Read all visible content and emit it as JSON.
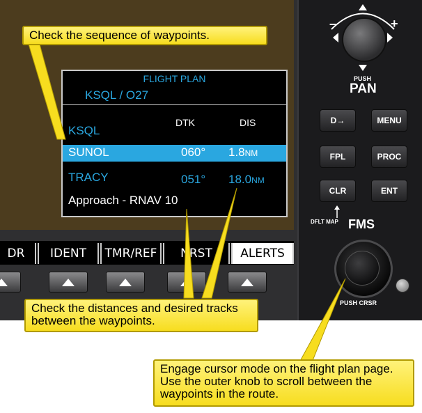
{
  "fpl": {
    "title": "FLIGHT PLAN",
    "route": "KSQL / O27",
    "col_dtk": "DTK",
    "col_dis": "DIS",
    "rows": [
      {
        "name": "KSQL",
        "dtk": "",
        "dis": "",
        "unit": ""
      },
      {
        "name": "SUNOL",
        "dtk": "060°",
        "dis": "1.8",
        "unit": "NM"
      },
      {
        "name": "TRACY",
        "dtk": "051°",
        "dis": "18.0",
        "unit": "NM"
      },
      {
        "name": "Approach - RNAV 10",
        "dtk": "",
        "dis": "",
        "unit": ""
      }
    ]
  },
  "softkeys": [
    "DR",
    "IDENT",
    "TMR/REF",
    "NRST",
    "ALERTS"
  ],
  "controls": {
    "push": "PUSH",
    "pan": "PAN",
    "minus": "–",
    "plus": "+",
    "direct_to": "D→",
    "menu": "MENU",
    "fpl": "FPL",
    "proc": "PROC",
    "clr": "CLR",
    "ent": "ENT",
    "dflt_map": "DFLT MAP",
    "fms": "FMS",
    "push_crsr": "PUSH CRSR"
  },
  "callouts": {
    "sequence": "Check the sequence of waypoints.",
    "distances": "Check the distances and desired tracks between the waypoints.",
    "cursor": "Engage cursor mode on the flight plan page. Use the outer knob to scroll between the waypoints in the route."
  },
  "colors": {
    "accent": "#2aa7e0",
    "callout": "#f7dd1f"
  }
}
